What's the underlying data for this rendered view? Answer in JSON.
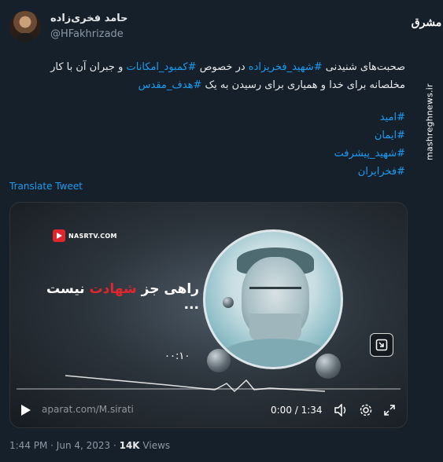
{
  "site": {
    "logo_text": "مشرق",
    "vertical_url": "mashreghnews.ir"
  },
  "author": {
    "name": "حامد فخری‌زاده",
    "handle": "@HFakhrizade",
    "avatar_icon": "user-avatar"
  },
  "tweet": {
    "line1_a": "صحبت‌های شنیدنی ",
    "tag1": "#شهید_فخریزاده",
    "line1_b": " در خصوص ",
    "tag2": "#کمبود_امکانات",
    "line1_c": " و جبران آن با کار",
    "line2_a": "مخلصانه برای خدا و همیاری برای رسیدن به یک ",
    "tag3": "#هدف_مقدس",
    "hashtags": [
      "#امید",
      "#ایمان",
      "#شهید_پیشرفت",
      "#فخرایران"
    ],
    "translate_label": "Translate Tweet"
  },
  "video": {
    "channel_logo": "NASRTV.COM",
    "line1": "راهی جز شهادت نیست ...",
    "line1_plain": "راهی جز ",
    "line1_red": "شهادت",
    "line1_rest": " نیست ...",
    "overlay_timer": "۰۰:۱۰",
    "watermark": "aparat.com/M.sirati",
    "time": "0:00 / 1:34",
    "progress_fraction": 0,
    "accent_red": "#e0262d"
  },
  "footer": {
    "timestamp": "1:44 PM · Jun 4, 2023 · ",
    "views_count": "14K",
    "views_label": " Views"
  }
}
